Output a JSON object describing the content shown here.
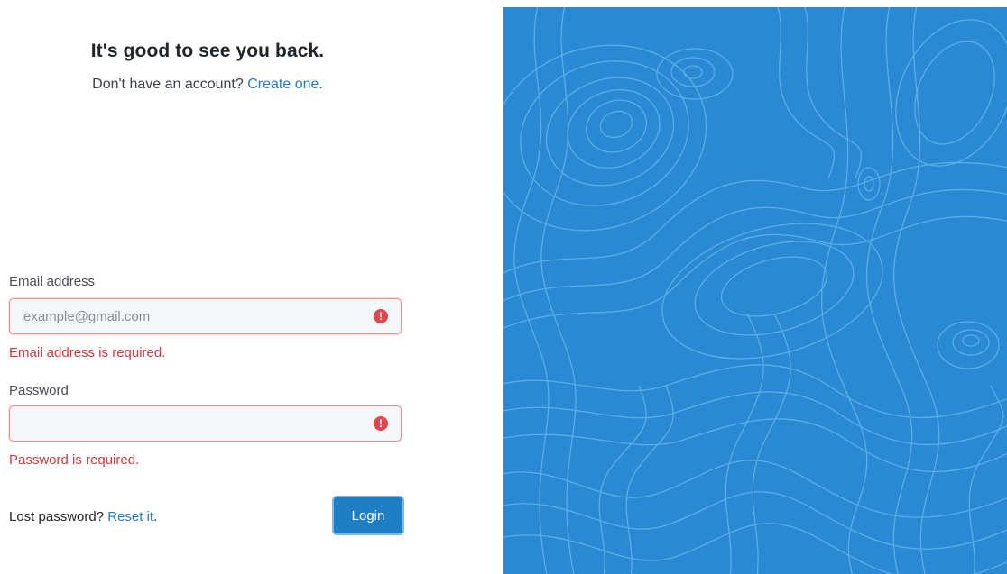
{
  "header": {
    "title": "It's good to see you back.",
    "subtitle_prefix": "Don't have an account?",
    "create_link": "Create one",
    "subtitle_suffix": "."
  },
  "form": {
    "email": {
      "label": "Email address",
      "placeholder": "example@gmail.com",
      "value": "",
      "error": "Email address is required."
    },
    "password": {
      "label": "Password",
      "placeholder": "",
      "value": "",
      "error": "Password is required."
    },
    "error_icon": "exclamation-circle-icon",
    "error_glyph": "!"
  },
  "footer": {
    "lost_prefix": "Lost password?",
    "reset_link": "Reset it",
    "lost_suffix": ".",
    "login_label": "Login"
  },
  "colors": {
    "accent": "#2a79c2",
    "error": "#d0393e",
    "button": "#1f7fc4",
    "panel_bg": "#2a89d3",
    "contour": "#5fb6ee"
  },
  "decoration": {
    "panel_pattern": "topographic-contour-lines"
  }
}
